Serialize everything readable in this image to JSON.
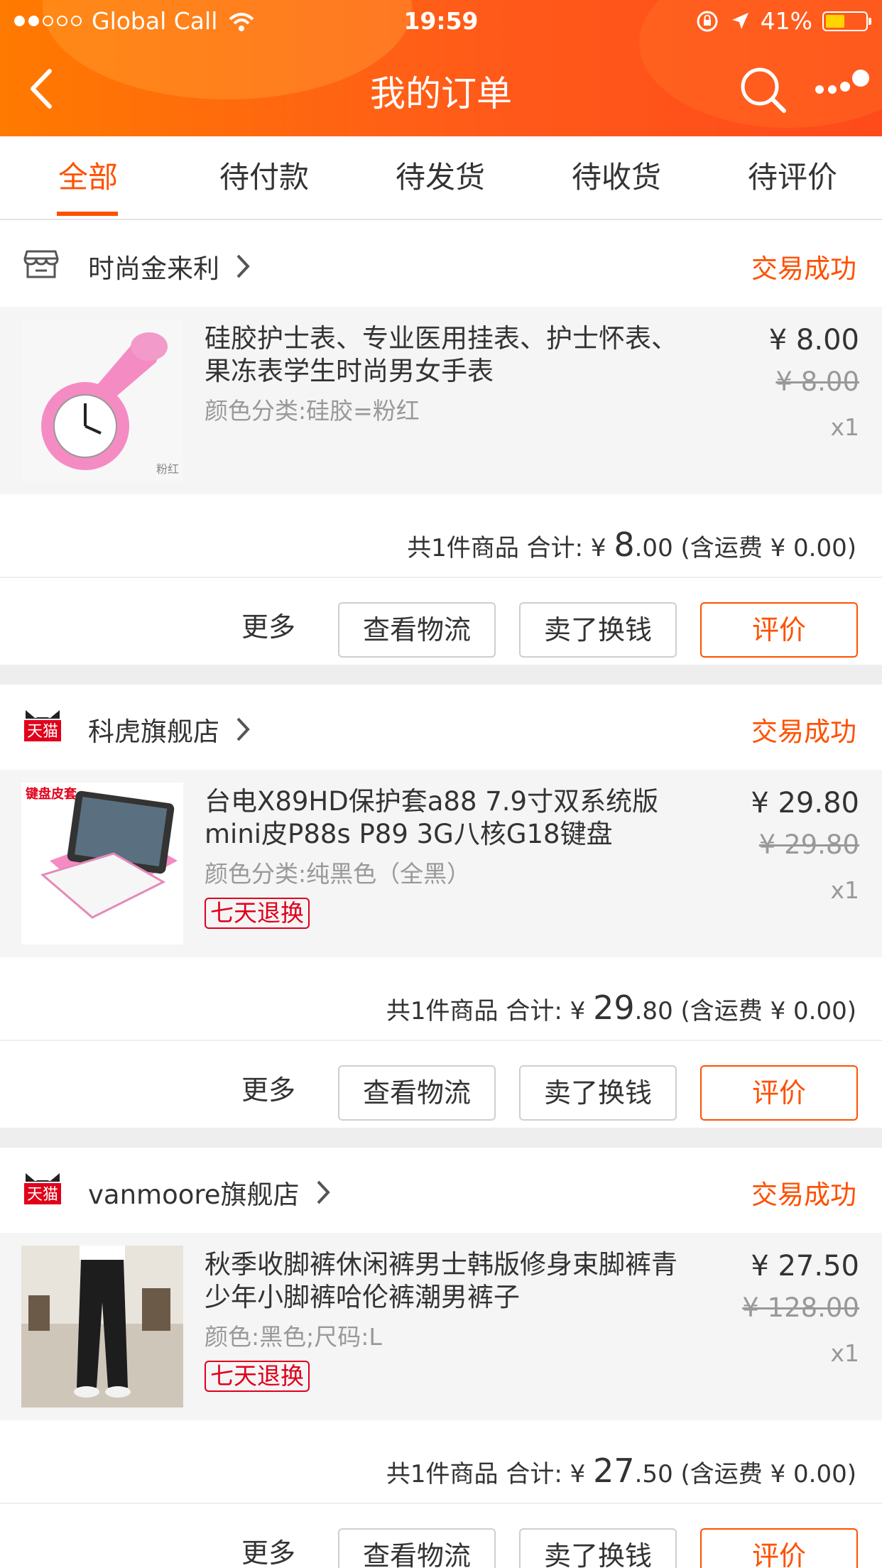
{
  "status_bar": {
    "carrier": "Global Call",
    "time": "19:59",
    "battery": "41%",
    "battery_level": 0.41
  },
  "header": {
    "title": "我的订单",
    "back_icon": "chevron-left-icon",
    "search_icon": "search-icon",
    "more_icon": "more-icon"
  },
  "tabs": [
    {
      "label": "全部",
      "active": true
    },
    {
      "label": "待付款",
      "active": false
    },
    {
      "label": "待发货",
      "active": false
    },
    {
      "label": "待收货",
      "active": false
    },
    {
      "label": "待评价",
      "active": false
    }
  ],
  "colors": {
    "accent": "#ff5000",
    "header_start": "#ff7a00",
    "header_end": "#ff4a1a"
  },
  "orders": [
    {
      "shop": "时尚金来利",
      "shop_icon": "store-icon",
      "status": "交易成功",
      "item": {
        "title": "硅胶护士表、专业医用挂表、护士怀表、果冻表学生时尚男女手表",
        "sku": "颜色分类:硅胶=粉红",
        "badge": "",
        "thumb_text": "粉红",
        "price": "¥ 8.00",
        "original_price": "¥ 8.00",
        "qty": "x1"
      },
      "summary": {
        "prefix": "共1件商品 合计: ¥ ",
        "int": "8",
        "dec": ".00",
        "shipping": " (含运费 ¥ 0.00)"
      },
      "actions": {
        "more": "更多",
        "logistics": "查看物流",
        "resell": "卖了换钱",
        "review": "评价"
      }
    },
    {
      "shop": "科虎旗舰店",
      "shop_icon": "tmall-icon",
      "status": "交易成功",
      "item": {
        "title": "台电X89HD保护套a88 7.9寸双系统版mini皮P88s P89 3G八核G18键盘",
        "sku": "颜色分类:纯黑色（全黑）",
        "badge": "七天退换",
        "thumb_text": "键盘皮套",
        "price": "¥ 29.80",
        "original_price": "¥ 29.80",
        "qty": "x1"
      },
      "summary": {
        "prefix": "共1件商品 合计: ¥ ",
        "int": "29",
        "dec": ".80",
        "shipping": " (含运费 ¥ 0.00)"
      },
      "actions": {
        "more": "更多",
        "logistics": "查看物流",
        "resell": "卖了换钱",
        "review": "评价"
      }
    },
    {
      "shop": "vanmoore旗舰店",
      "shop_icon": "tmall-icon",
      "status": "交易成功",
      "item": {
        "title": "秋季收脚裤休闲裤男士韩版修身束脚裤青少年小脚裤哈伦裤潮男裤子",
        "sku": "颜色:黑色;尺码:L",
        "badge": "七天退换",
        "thumb_text": "",
        "price": "¥ 27.50",
        "original_price": "¥ 128.00",
        "qty": "x1"
      },
      "summary": {
        "prefix": "共1件商品 合计: ¥ ",
        "int": "27",
        "dec": ".50",
        "shipping": " (含运费 ¥ 0.00)"
      },
      "actions": {
        "more": "更多",
        "logistics": "查看物流",
        "resell": "卖了换钱",
        "review": "评价"
      }
    }
  ],
  "tmall_badge_text": "天猫"
}
